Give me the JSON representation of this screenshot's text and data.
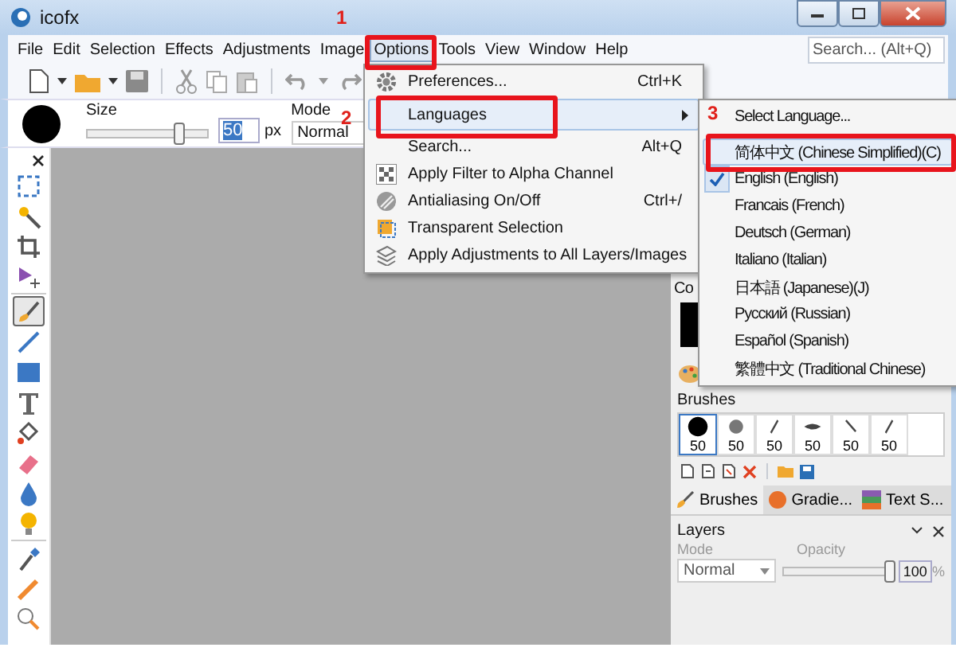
{
  "window": {
    "title": "icofx"
  },
  "menu_bar": {
    "items": [
      {
        "label": "File",
        "selected": false
      },
      {
        "label": "Edit",
        "selected": false
      },
      {
        "label": "Selection",
        "selected": false
      },
      {
        "label": "Effects",
        "selected": false
      },
      {
        "label": "Adjustments",
        "selected": false
      },
      {
        "label": "Image",
        "selected": false
      },
      {
        "label": "Options",
        "selected": true
      },
      {
        "label": "Tools",
        "selected": false
      },
      {
        "label": "View",
        "selected": false
      },
      {
        "label": "Window",
        "selected": false
      },
      {
        "label": "Help",
        "selected": false
      }
    ],
    "search": {
      "placeholder": "Search... (Alt+Q)"
    }
  },
  "tool_options": {
    "size_label": "Size",
    "size_slider": {
      "level": 0.78
    },
    "size_value": "50",
    "size_unit": "px",
    "mode_label": "Mode",
    "mode_value": "Normal"
  },
  "toolbox": {
    "groups": [
      [
        {
          "kind": "marquee",
          "selected": false
        },
        {
          "kind": "wand",
          "selected": false
        },
        {
          "kind": "crop",
          "selected": false
        },
        {
          "kind": "move",
          "selected": false
        }
      ],
      [
        {
          "kind": "brush",
          "selected": true
        },
        {
          "kind": "line",
          "selected": false
        },
        {
          "kind": "rectangle",
          "selected": false
        },
        {
          "kind": "text",
          "selected": false
        },
        {
          "kind": "fill",
          "selected": false
        },
        {
          "kind": "eraser",
          "selected": false
        },
        {
          "kind": "drop",
          "selected": false
        },
        {
          "kind": "bulb",
          "selected": false
        }
      ],
      [
        {
          "kind": "eyedropper",
          "selected": false
        },
        {
          "kind": "pencil",
          "selected": false
        },
        {
          "kind": "zoom",
          "selected": false
        }
      ]
    ]
  },
  "right_panel": {
    "color_title": "Co",
    "brushes": {
      "title": "Brushes",
      "presets": [
        {
          "label": "50",
          "kind": "round",
          "selected": true
        },
        {
          "label": "50",
          "kind": "soft",
          "selected": false
        },
        {
          "label": "50",
          "kind": "slant",
          "selected": false
        },
        {
          "label": "50",
          "kind": "flat",
          "selected": false
        },
        {
          "label": "50",
          "kind": "backslant",
          "selected": false
        },
        {
          "label": "50",
          "kind": "slant",
          "selected": false
        }
      ],
      "tabs": [
        {
          "label": "Brushes",
          "kind": "brush",
          "selected": true
        },
        {
          "label": "Gradie...",
          "kind": "gradient",
          "selected": false
        },
        {
          "label": "Text S...",
          "kind": "text",
          "selected": false
        }
      ]
    },
    "layers": {
      "title": "Layers",
      "mode_label": "Mode",
      "mode_value": "Normal",
      "opacity_label": "Opacity",
      "opacity_slider": {
        "level": 1
      },
      "opacity_value": "100",
      "opacity_unit": "%"
    }
  },
  "options_menu": {
    "items": [
      {
        "label": "Preferences...",
        "shortcut": "Ctrl+K",
        "has_submenu": false,
        "highlighted": false
      },
      {
        "label": "Languages",
        "has_submenu": true,
        "highlighted": true
      },
      {
        "label": "Search...",
        "shortcut": "Alt+Q",
        "has_submenu": false,
        "highlighted": false
      },
      {
        "label": "Apply Filter to Alpha Channel",
        "has_submenu": false,
        "highlighted": false
      },
      {
        "label": "Antialiasing On/Off",
        "shortcut": "Ctrl+/",
        "has_submenu": false,
        "highlighted": false
      },
      {
        "label": "Transparent Selection",
        "has_submenu": false,
        "highlighted": false
      },
      {
        "label": "Apply Adjustments to All Layers/Images",
        "has_submenu": false,
        "highlighted": false
      }
    ]
  },
  "languages_menu": {
    "items": [
      {
        "label": "Select Language...",
        "kind": "command",
        "checked": false,
        "highlighted": false
      },
      {
        "label": "简体中文 (Chinese Simplified)(C)",
        "kind": "language",
        "checked": false,
        "highlighted": true
      },
      {
        "label": "English (English)",
        "kind": "language",
        "checked": true,
        "highlighted": false
      },
      {
        "label": "Francais (French)",
        "kind": "language",
        "checked": false,
        "highlighted": false
      },
      {
        "label": "Deutsch (German)",
        "kind": "language",
        "checked": false,
        "highlighted": false
      },
      {
        "label": "Italiano (Italian)",
        "kind": "language",
        "checked": false,
        "highlighted": false
      },
      {
        "label": "日本語 (Japanese)(J)",
        "kind": "language",
        "checked": false,
        "highlighted": false
      },
      {
        "label": "Русский (Russian)",
        "kind": "language",
        "checked": false,
        "highlighted": false
      },
      {
        "label": "Español (Spanish)",
        "kind": "language",
        "checked": false,
        "highlighted": false
      },
      {
        "label": "繁體中文 (Traditional Chinese)",
        "kind": "language",
        "checked": false,
        "highlighted": false
      }
    ]
  },
  "annotations": [
    {
      "label": "1"
    },
    {
      "label": "2"
    },
    {
      "label": "3"
    }
  ]
}
